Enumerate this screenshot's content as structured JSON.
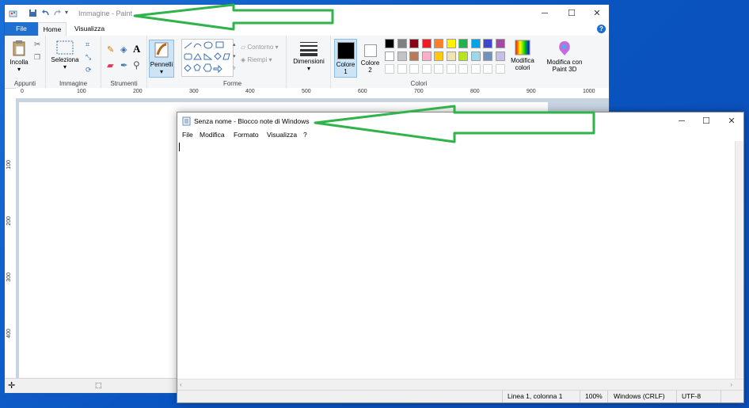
{
  "paint": {
    "title": "Immagine - Paint",
    "tabs": {
      "file": "File",
      "home": "Home",
      "view": "Visualizza"
    },
    "help": "?",
    "groups": {
      "clipboard": {
        "label": "Appunti",
        "paste": "Incolla"
      },
      "image": {
        "label": "Immagine",
        "select": "Seleziona"
      },
      "tools": {
        "label": "Strumenti"
      },
      "brushes": {
        "label": "Pennelli"
      },
      "shapes": {
        "label": "Forme",
        "outline": "Contorno",
        "fill": "Riempi"
      },
      "size": {
        "label": "Dimensioni"
      },
      "colors": {
        "label": "Colori",
        "color1": "Colore 1",
        "color2": "Colore 2",
        "edit": "Modifica colori",
        "paint3d": "Modifica con Paint 3D"
      }
    },
    "ruler_h": [
      "0",
      "100",
      "200",
      "300",
      "400",
      "500",
      "600",
      "700",
      "800",
      "900",
      "1000"
    ],
    "ruler_v": [
      "100",
      "200",
      "300",
      "400"
    ],
    "palette_row1": [
      "#000000",
      "#7f7f7f",
      "#880015",
      "#ed1c24",
      "#ff7f27",
      "#fff200",
      "#22b14c",
      "#00a2e8",
      "#3f48cc",
      "#a349a4"
    ],
    "palette_row2": [
      "#ffffff",
      "#c3c3c3",
      "#b97a57",
      "#ffaec9",
      "#ffc90e",
      "#efe4b0",
      "#b5e61d",
      "#99d9ea",
      "#7092be",
      "#c8bfe7"
    ]
  },
  "notepad": {
    "title": "Senza nome - Blocco note di Windows",
    "menu": [
      "File",
      "Modifica",
      "Formato",
      "Visualizza",
      "?"
    ],
    "status": {
      "position": "Linea 1, colonna 1",
      "zoom": "100%",
      "eol": "Windows (CRLF)",
      "encoding": "UTF-8"
    }
  },
  "colors": {
    "accent": "#1e6fd0",
    "arrow": "#2fb34a"
  }
}
